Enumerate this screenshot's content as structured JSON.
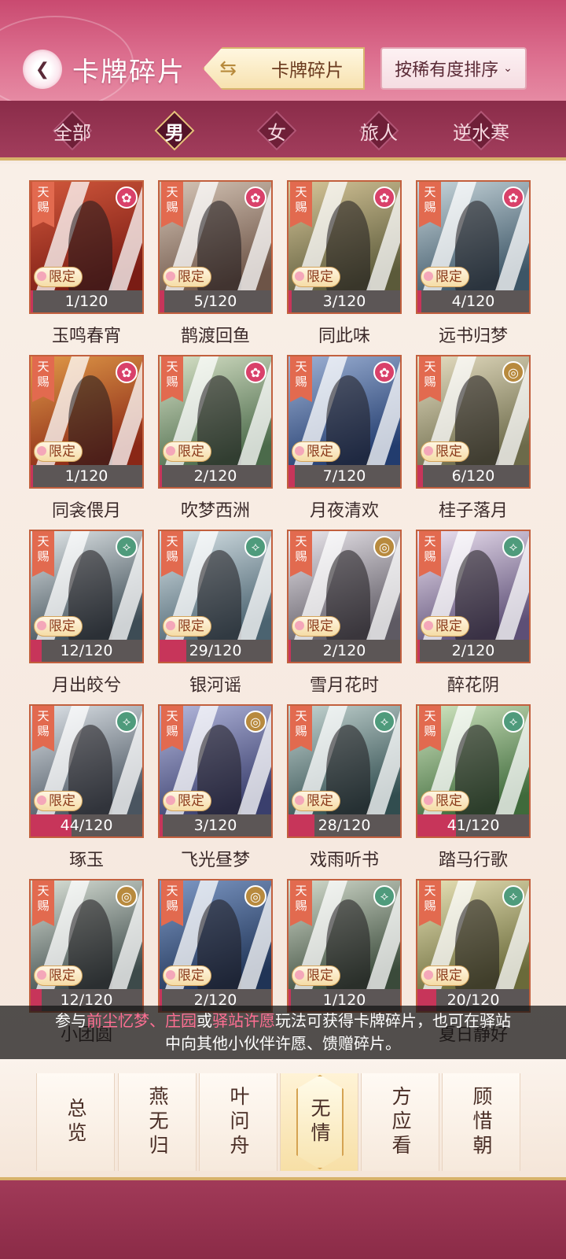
{
  "header": {
    "title": "卡牌碎片",
    "switch_label": "卡牌碎片",
    "sort_label": "按稀有度排序"
  },
  "filters": [
    "全部",
    "男",
    "女",
    "旅人",
    "逆水寒"
  ],
  "active_filter": "男",
  "card_common": {
    "ribbon_line1": "天",
    "ribbon_line2": "赐",
    "limited_label": "限定"
  },
  "cards": [
    {
      "name": "玉鸣春宵",
      "count": "1/120",
      "progress": 0.0083,
      "emblem": "flower",
      "palette": [
        "#7a1c14",
        "#d2583c"
      ]
    },
    {
      "name": "鹊渡回鱼",
      "count": "5/120",
      "progress": 0.0417,
      "emblem": "flower",
      "palette": [
        "#6d5447",
        "#d7c7b8"
      ]
    },
    {
      "name": "同此味",
      "count": "3/120",
      "progress": 0.025,
      "emblem": "flower",
      "palette": [
        "#5b5a3a",
        "#d8c79a"
      ]
    },
    {
      "name": "远书归梦",
      "count": "4/120",
      "progress": 0.0333,
      "emblem": "flower",
      "palette": [
        "#3c5566",
        "#c9d7dc"
      ]
    },
    {
      "name": "同衾偎月",
      "count": "1/120",
      "progress": 0.0083,
      "emblem": "flower",
      "palette": [
        "#8a2716",
        "#e09a48"
      ]
    },
    {
      "name": "吹梦西洲",
      "count": "2/120",
      "progress": 0.0167,
      "emblem": "flower",
      "palette": [
        "#4b6a4a",
        "#d9e3c9"
      ]
    },
    {
      "name": "月夜清欢",
      "count": "7/120",
      "progress": 0.0583,
      "emblem": "flower",
      "palette": [
        "#223c6e",
        "#9fb3d6"
      ]
    },
    {
      "name": "桂子落月",
      "count": "6/120",
      "progress": 0.05,
      "emblem": "coin",
      "palette": [
        "#6c6a4a",
        "#e7dfc3"
      ]
    },
    {
      "name": "月出皎兮",
      "count": "12/120",
      "progress": 0.1,
      "emblem": "leaf",
      "palette": [
        "#3d4c55",
        "#e3e8ea"
      ]
    },
    {
      "name": "银河谣",
      "count": "29/120",
      "progress": 0.2417,
      "emblem": "leaf",
      "palette": [
        "#4b6370",
        "#dbe6ea"
      ]
    },
    {
      "name": "雪月花时",
      "count": "2/120",
      "progress": 0.0167,
      "emblem": "coin",
      "palette": [
        "#5e5a63",
        "#ece8ee"
      ]
    },
    {
      "name": "醉花阴",
      "count": "2/120",
      "progress": 0.0167,
      "emblem": "leaf",
      "palette": [
        "#5d4f76",
        "#efe4f3"
      ]
    },
    {
      "name": "琢玉",
      "count": "44/120",
      "progress": 0.3667,
      "emblem": "leaf",
      "palette": [
        "#4a5560",
        "#dfe4e9"
      ]
    },
    {
      "name": "飞光昼梦",
      "count": "3/120",
      "progress": 0.025,
      "emblem": "coin",
      "palette": [
        "#3a3f6d",
        "#b5b9de"
      ]
    },
    {
      "name": "戏雨听书",
      "count": "28/120",
      "progress": 0.2333,
      "emblem": "leaf",
      "palette": [
        "#314d4f",
        "#c6d6d3"
      ]
    },
    {
      "name": "踏马行歌",
      "count": "41/120",
      "progress": 0.3417,
      "emblem": "leaf",
      "palette": [
        "#3f6a3b",
        "#d2e7c2"
      ]
    },
    {
      "name": "小团圆",
      "count": "12/120",
      "progress": 0.1,
      "emblem": "coin",
      "palette": [
        "#3d4a4a",
        "#dce3d9"
      ]
    },
    {
      "name": "",
      "count": "2/120",
      "progress": 0.0167,
      "emblem": "coin",
      "palette": [
        "#203456",
        "#7f9ac7"
      ]
    },
    {
      "name": "",
      "count": "1/120",
      "progress": 0.0083,
      "emblem": "leaf",
      "palette": [
        "#3a4a3a",
        "#d5ddcf"
      ]
    },
    {
      "name": "夏日静好",
      "count": "20/120",
      "progress": 0.1667,
      "emblem": "leaf",
      "palette": [
        "#6a6a3a",
        "#e9e3b8"
      ]
    }
  ],
  "tip": {
    "line1_pre": "参与",
    "hl1": "前尘忆梦、庄园",
    "mid": "或",
    "hl2": "驿站许愿",
    "line1_post": "玩法可获得卡牌碎片，也可在驿站",
    "line2": "中向其他小伙伴许愿、馈赠碎片。"
  },
  "tabs": [
    "总览",
    "燕无归",
    "叶问舟",
    "无情",
    "方应看",
    "顾惜朝"
  ],
  "active_tab": "无情",
  "colors": {
    "accent": "#c7355a",
    "header": "#c94a70",
    "gold": "#d7b26a"
  },
  "icons": {
    "back": "back-arrow-icon",
    "switch": "swap-icon",
    "sort": "chevron-down-icon"
  }
}
